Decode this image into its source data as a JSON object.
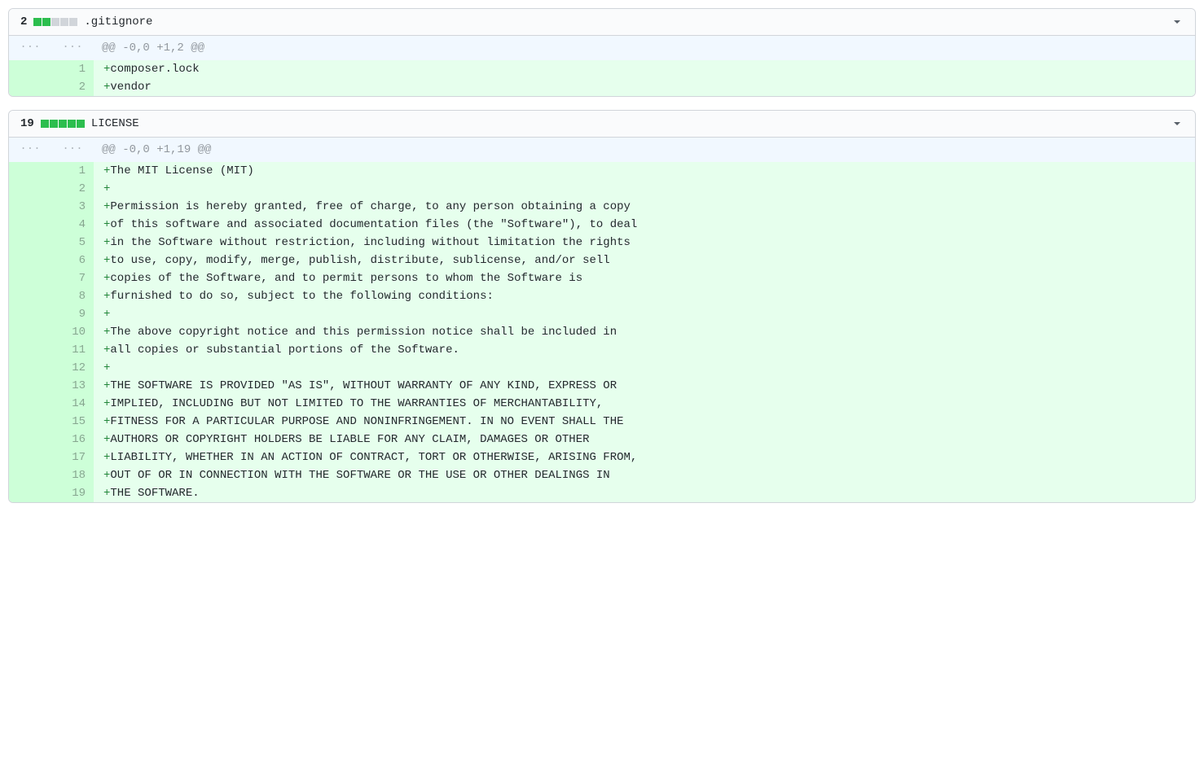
{
  "files": [
    {
      "changes": "2",
      "stat_added": 2,
      "stat_total": 5,
      "filename": ".gitignore",
      "hunk_header": "@@ -0,0 +1,2 @@",
      "lines": [
        {
          "new_num": "1",
          "text": "composer.lock"
        },
        {
          "new_num": "2",
          "text": "vendor"
        }
      ]
    },
    {
      "changes": "19",
      "stat_added": 5,
      "stat_total": 5,
      "filename": "LICENSE",
      "hunk_header": "@@ -0,0 +1,19 @@",
      "lines": [
        {
          "new_num": "1",
          "text": "The MIT License (MIT)"
        },
        {
          "new_num": "2",
          "text": ""
        },
        {
          "new_num": "3",
          "text": "Permission is hereby granted, free of charge, to any person obtaining a copy"
        },
        {
          "new_num": "4",
          "text": "of this software and associated documentation files (the \"Software\"), to deal"
        },
        {
          "new_num": "5",
          "text": "in the Software without restriction, including without limitation the rights"
        },
        {
          "new_num": "6",
          "text": "to use, copy, modify, merge, publish, distribute, sublicense, and/or sell"
        },
        {
          "new_num": "7",
          "text": "copies of the Software, and to permit persons to whom the Software is"
        },
        {
          "new_num": "8",
          "text": "furnished to do so, subject to the following conditions:"
        },
        {
          "new_num": "9",
          "text": ""
        },
        {
          "new_num": "10",
          "text": "The above copyright notice and this permission notice shall be included in"
        },
        {
          "new_num": "11",
          "text": "all copies or substantial portions of the Software."
        },
        {
          "new_num": "12",
          "text": ""
        },
        {
          "new_num": "13",
          "text": "THE SOFTWARE IS PROVIDED \"AS IS\", WITHOUT WARRANTY OF ANY KIND, EXPRESS OR"
        },
        {
          "new_num": "14",
          "text": "IMPLIED, INCLUDING BUT NOT LIMITED TO THE WARRANTIES OF MERCHANTABILITY,"
        },
        {
          "new_num": "15",
          "text": "FITNESS FOR A PARTICULAR PURPOSE AND NONINFRINGEMENT. IN NO EVENT SHALL THE"
        },
        {
          "new_num": "16",
          "text": "AUTHORS OR COPYRIGHT HOLDERS BE LIABLE FOR ANY CLAIM, DAMAGES OR OTHER"
        },
        {
          "new_num": "17",
          "text": "LIABILITY, WHETHER IN AN ACTION OF CONTRACT, TORT OR OTHERWISE, ARISING FROM,"
        },
        {
          "new_num": "18",
          "text": "OUT OF OR IN CONNECTION WITH THE SOFTWARE OR THE USE OR OTHER DEALINGS IN"
        },
        {
          "new_num": "19",
          "text": "THE SOFTWARE."
        }
      ]
    }
  ],
  "ellipsis": "..."
}
